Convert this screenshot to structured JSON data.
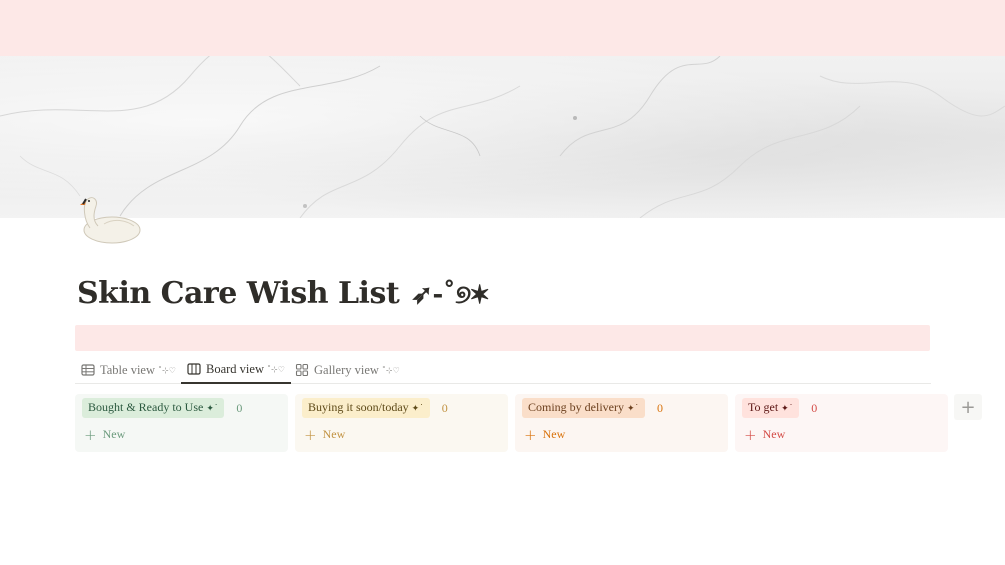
{
  "page": {
    "title": "Skin Care Wish List",
    "title_deco": "➶-˚୭✶",
    "icon": "swan-icon"
  },
  "colors": {
    "top_band": "#fde8e7",
    "callout": "#fde8e7"
  },
  "views": [
    {
      "label": "Table view",
      "deco": "˚⊹♡",
      "icon": "table-icon",
      "active": false
    },
    {
      "label": "Board view",
      "deco": "˚⊹♡",
      "icon": "board-icon",
      "active": true
    },
    {
      "label": "Gallery view",
      "deco": "˚⊹♡",
      "icon": "gallery-icon",
      "active": false
    }
  ],
  "board": {
    "columns": [
      {
        "label": "Bought & Ready to Use",
        "deco": "✦˙",
        "count": "0",
        "new_label": "New",
        "color": "#dbeddb"
      },
      {
        "label": "Buying it soon/today",
        "deco": "✦˙",
        "count": "0",
        "new_label": "New",
        "color": "#fbeecb"
      },
      {
        "label": "Coming by delivery",
        "deco": "✦˙",
        "count": "0",
        "new_label": "New",
        "color": "#fadec9"
      },
      {
        "label": "To get",
        "deco": "✦˙",
        "count": "0",
        "new_label": "New",
        "color": "#ffe2dd"
      }
    ],
    "add_group_label": "+"
  }
}
